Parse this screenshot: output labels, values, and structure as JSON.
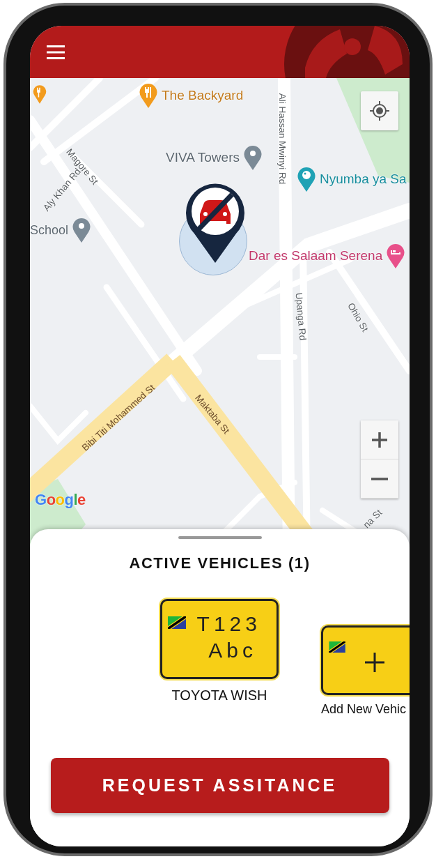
{
  "map": {
    "places": [
      {
        "kind": "restaurant",
        "name": "The Backyard",
        "color": "#f29b1d"
      },
      {
        "kind": "landmark",
        "name": "VIVA Towers",
        "color": "#7b8a96"
      },
      {
        "kind": "landmark",
        "name": "School",
        "color": "#7b8a96"
      },
      {
        "kind": "museum",
        "name": "Nyumba ya Sa",
        "color": "#1fa2b5"
      },
      {
        "kind": "hotel",
        "name": "Dar es Salaam Serena",
        "color": "#e8508a"
      }
    ],
    "streets": [
      "Magore St",
      "Aly Khan Rd",
      "Ali Hassan Mwinyi Rd",
      "Upanga Rd",
      "Ohio St",
      "Bibi Titi Mohammed St",
      "Maktaba St",
      "na St"
    ],
    "attribution": "Google"
  },
  "sheet": {
    "title": "ACTIVE VEHICLES (1)",
    "vehicles": [
      {
        "kind": "plate",
        "line_1": "T123",
        "line_2": "Abc",
        "name": "TOYOTA WISH"
      },
      {
        "kind": "add",
        "name": "Add New Vehic"
      }
    ],
    "button": "REQUEST ASSITANCE"
  }
}
